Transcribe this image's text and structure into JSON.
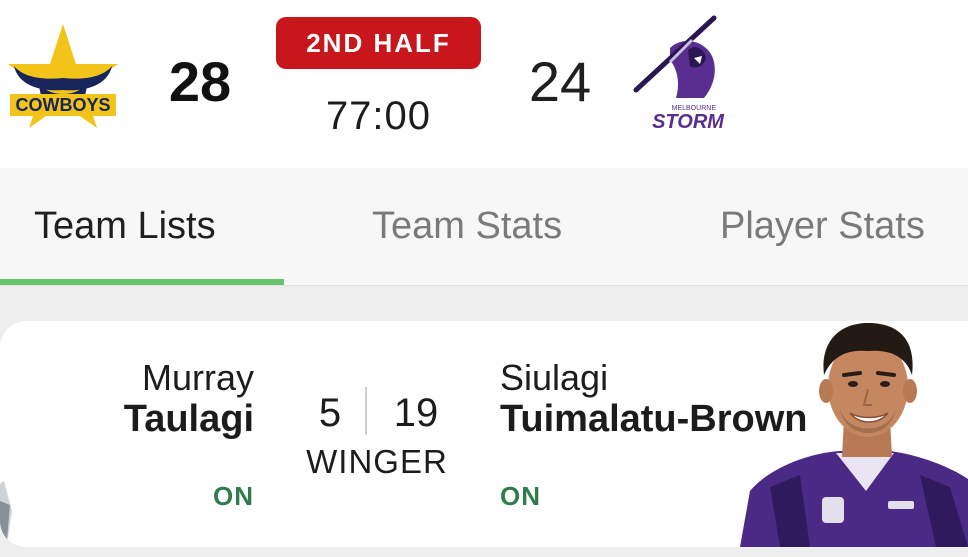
{
  "match": {
    "home": {
      "name": "COWBOYS",
      "score": "28"
    },
    "away": {
      "name": "STORM",
      "sub": "MELBOURNE",
      "score": "24"
    },
    "period": "2ND HALF",
    "clock": "77:00"
  },
  "tabs": [
    {
      "label": "Team Lists",
      "active": true
    },
    {
      "label": "Team Stats",
      "active": false
    },
    {
      "label": "Player Stats",
      "active": false
    }
  ],
  "matchup": {
    "home_player": {
      "first_name": "Murray",
      "last_name": "Taulagi",
      "number": "5",
      "status": "ON"
    },
    "away_player": {
      "first_name": "Siulagi",
      "last_name": "Tuimalatu-Brown",
      "number": "19",
      "status": "ON"
    },
    "position": "WINGER"
  },
  "colors": {
    "period_badge": "#c8161d",
    "active_tab_indicator": "#67c36b",
    "status_on": "#2e7d4a",
    "cowboys_navy": "#17255a",
    "cowboys_gold": "#f2c419",
    "storm_purple": "#5a2d91"
  },
  "icons": {
    "home_logo": "cowboys-logo",
    "away_logo": "storm-logo",
    "away_player_photo": "player-photo"
  }
}
